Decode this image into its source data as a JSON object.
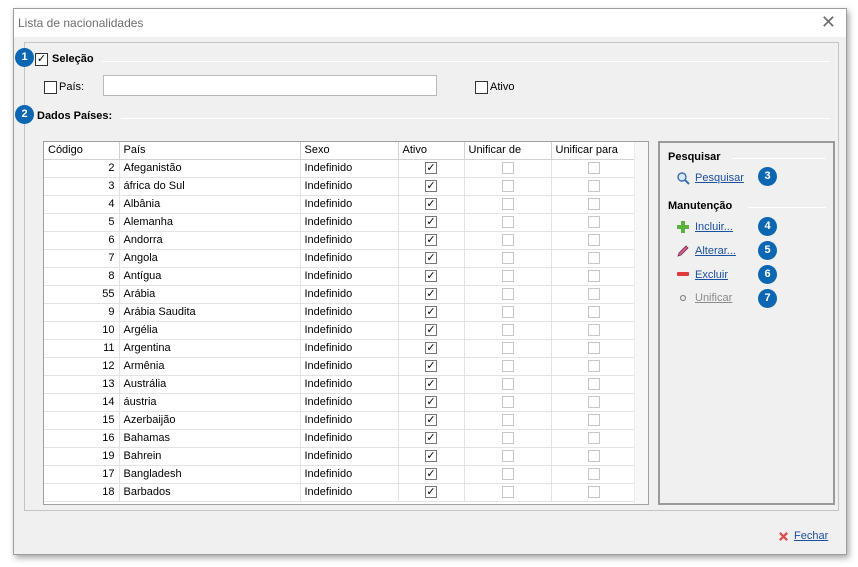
{
  "window": {
    "title": "Lista de nacionalidades"
  },
  "badges": [
    "1",
    "2",
    "3",
    "4",
    "5",
    "6",
    "7"
  ],
  "selecao": {
    "title": "Seleção",
    "pais_label": "País:",
    "pais_value": "",
    "ativo_label": "Ativo"
  },
  "dados": {
    "title": "Dados Países:"
  },
  "grid": {
    "columns": [
      "Código",
      "País",
      "Sexo",
      "Ativo",
      "Unificar de",
      "Unificar para"
    ],
    "rows": [
      {
        "codigo": "2",
        "pais": "Afeganistão",
        "sexo": "Indefinido"
      },
      {
        "codigo": "3",
        "pais": "áfrica do Sul",
        "sexo": "Indefinido"
      },
      {
        "codigo": "4",
        "pais": "Albânia",
        "sexo": "Indefinido"
      },
      {
        "codigo": "5",
        "pais": "Alemanha",
        "sexo": "Indefinido"
      },
      {
        "codigo": "6",
        "pais": "Andorra",
        "sexo": "Indefinido"
      },
      {
        "codigo": "7",
        "pais": "Angola",
        "sexo": "Indefinido"
      },
      {
        "codigo": "8",
        "pais": "Antígua",
        "sexo": "Indefinido"
      },
      {
        "codigo": "55",
        "pais": "Arábia",
        "sexo": "Indefinido"
      },
      {
        "codigo": "9",
        "pais": "Arábia Saudita",
        "sexo": "Indefinido"
      },
      {
        "codigo": "10",
        "pais": "Argélia",
        "sexo": "Indefinido"
      },
      {
        "codigo": "11",
        "pais": "Argentina",
        "sexo": "Indefinido"
      },
      {
        "codigo": "12",
        "pais": "Armênia",
        "sexo": "Indefinido"
      },
      {
        "codigo": "13",
        "pais": "Austrália",
        "sexo": "Indefinido"
      },
      {
        "codigo": "14",
        "pais": "áustria",
        "sexo": "Indefinido"
      },
      {
        "codigo": "15",
        "pais": "Azerbaijão",
        "sexo": "Indefinido"
      },
      {
        "codigo": "16",
        "pais": "Bahamas",
        "sexo": "Indefinido"
      },
      {
        "codigo": "19",
        "pais": "Bahrein",
        "sexo": "Indefinido"
      },
      {
        "codigo": "17",
        "pais": "Bangladesh",
        "sexo": "Indefinido"
      },
      {
        "codigo": "18",
        "pais": "Barbados",
        "sexo": "Indefinido"
      }
    ]
  },
  "sidebar": {
    "pesquisar_title": "Pesquisar",
    "pesquisar_link": "Pesquisar",
    "manutencao_title": "Manutenção",
    "incluir": "Incluir...",
    "alterar": "Alterar...",
    "excluir": "Excluir",
    "unificar": "Unificar"
  },
  "footer": {
    "fechar": "Fechar"
  },
  "colors": {
    "accent": "#0b67b2",
    "link": "#1b4fa0"
  }
}
